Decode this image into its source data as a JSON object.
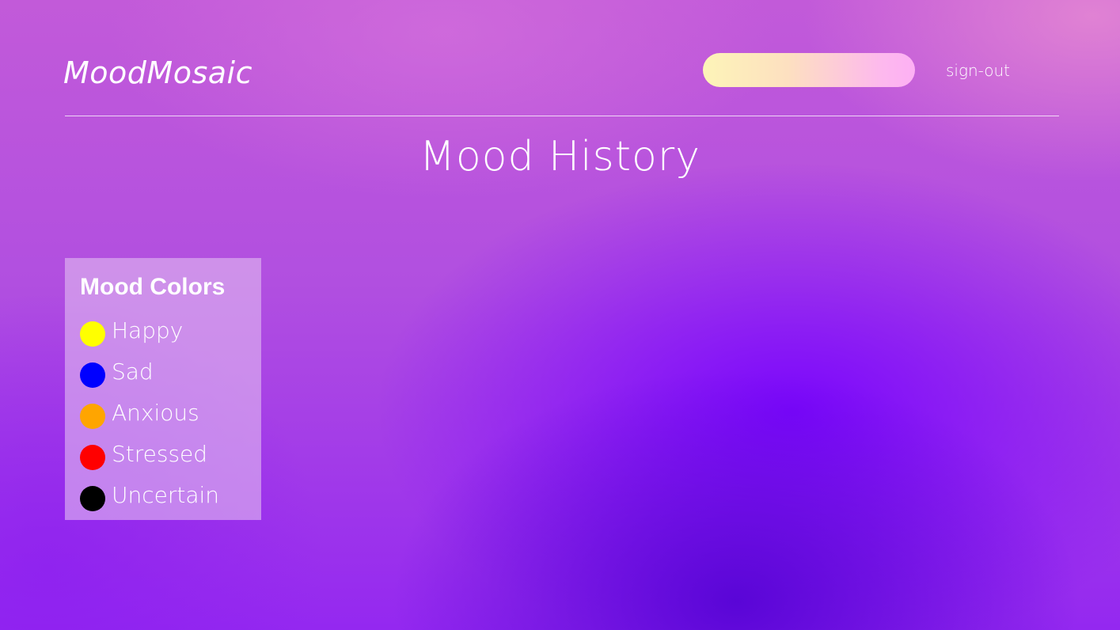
{
  "header": {
    "brand": "MoodMosaic",
    "search": {
      "value": "",
      "placeholder": ""
    },
    "signout_label": "sign-out"
  },
  "main": {
    "title": "Mood History"
  },
  "legend": {
    "title": "Mood Colors",
    "items": [
      {
        "label": "Happy",
        "color": "#ffff00"
      },
      {
        "label": "Sad",
        "color": "#0000ff"
      },
      {
        "label": "Anxious",
        "color": "#ffa500"
      },
      {
        "label": "Stressed",
        "color": "#ff0000"
      },
      {
        "label": "Uncertain",
        "color": "#000000"
      }
    ]
  },
  "colors": {
    "pill_gradient_start": "#fdf4b8",
    "pill_gradient_end": "#fdb0f4",
    "background_top": "#c25ad9",
    "background_bottom": "#7a00ff"
  }
}
